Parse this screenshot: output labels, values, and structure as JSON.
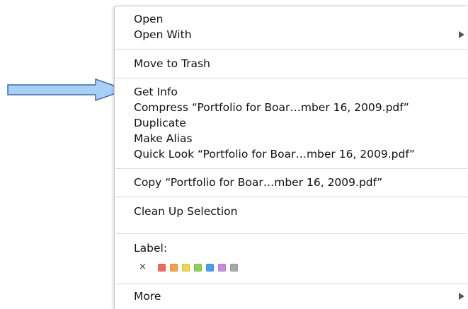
{
  "menu": {
    "open": "Open",
    "open_with": "Open With",
    "move_to_trash": "Move to Trash",
    "get_info": "Get Info",
    "compress": "Compress “Portfolio for Boar…mber 16, 2009.pdf”",
    "duplicate": "Duplicate",
    "make_alias": "Make Alias",
    "quick_look": "Quick Look “Portfolio for Boar…mber 16, 2009.pdf”",
    "copy": "Copy “Portfolio for Boar…mber 16, 2009.pdf”",
    "clean_up": "Clean Up Selection",
    "label_heading": "Label:",
    "label_none": "×",
    "label_colors": [
      "#ef6b61",
      "#f2a24a",
      "#f0d650",
      "#8fd05a",
      "#4a9ff0",
      "#c58ee3",
      "#a9a9a9"
    ],
    "more": "More"
  },
  "annotation": {
    "arrow_fill": "#a7cff7",
    "arrow_stroke": "#3d6ea3"
  }
}
